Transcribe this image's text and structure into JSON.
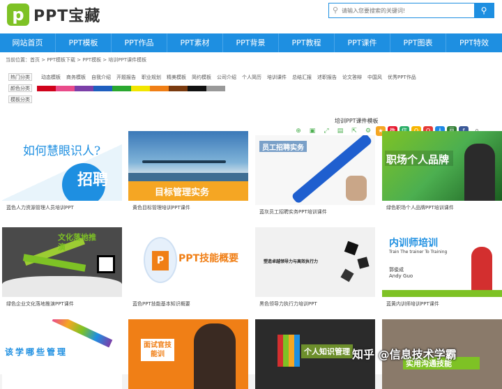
{
  "brand": {
    "name": "PPT宝藏",
    "logo_letter": "p",
    "accent": "#1e8fe1",
    "logo_color": "#7ec225"
  },
  "search": {
    "placeholder": "请输入您要搜索的关键词!",
    "icon": "search-icon",
    "button_icon": "search-icon"
  },
  "nav": [
    "网站首页",
    "PPT模板",
    "PPT作品",
    "PPT素材",
    "PPT背景",
    "PPT教程",
    "PPT课件",
    "PPT图表",
    "PPT特效"
  ],
  "breadcrumb": "当前位置：首页 > PPT模板下载 > PPT模板 > 培训PPT课件模板",
  "filters": {
    "hot_label": "热门分类",
    "hot_items": [
      "动态模板",
      "商务模板",
      "自我介绍",
      "开题报告",
      "职业规划",
      "精美模板",
      "简约模板",
      "公司介绍",
      "个人简历",
      "培训课件",
      "总结汇报",
      "述职报告",
      "论文答辩",
      "中国风",
      "优秀PPT作品"
    ],
    "color_label": "颜色分类",
    "colors": [
      "#d0021b",
      "#e94b8a",
      "#7b3fa8",
      "#1e5fbf",
      "#2aa830",
      "#f2e600",
      "#f07f16",
      "#7a3a0f",
      "#111111",
      "#999999"
    ],
    "template_label": "模板分类"
  },
  "section_title": "培训PPT课件模板",
  "share": {
    "count": "0"
  },
  "cards": [
    {
      "caption": "蓝色人力资源管理人员培训PPT",
      "title": "招聘",
      "subtitle": "如何慧眼识人?"
    },
    {
      "caption": "黄色目标管理培训PPT课件",
      "title": "目标管理实务"
    },
    {
      "caption": "蓝灰员工招聘实务PPT培训课件",
      "title": "员工招聘实务"
    },
    {
      "caption": "绿色职场个人品牌PPT培训课件",
      "title": "职场个人品牌"
    },
    {
      "caption": "绿色企业文化落地推演PPT课件",
      "title": "文化落地推演"
    },
    {
      "caption": "蓝色PPT技能基本知识概要",
      "title": "PPT技能概要"
    },
    {
      "caption": "黑色领导力执行力培训PPT",
      "title": "塑造卓越领导力与高效执行力"
    },
    {
      "caption": "蓝黄内训师培训PPT课件",
      "title": "内训师培训",
      "subtitle": "Train The trainer To Training",
      "name": "郭俊成",
      "name_en": "Andy Guo"
    },
    {
      "title": "该学哪些管理"
    },
    {
      "title": "面试官技能训"
    },
    {
      "title": "个人知识管理"
    },
    {
      "title": "实用沟通技能"
    }
  ],
  "watermark": "知乎 @信息技术学霸"
}
